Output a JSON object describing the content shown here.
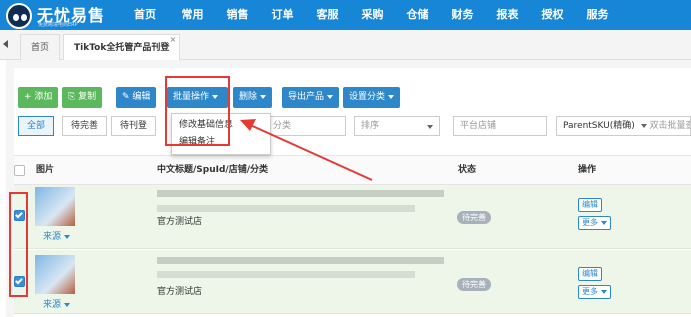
{
  "app": {
    "name": "无忧易售",
    "subtitle": "免费跨境电商ERP"
  },
  "menu": [
    "首页",
    "常用",
    "销售",
    "订单",
    "客服",
    "采购",
    "仓储",
    "财务",
    "报表",
    "授权",
    "服务"
  ],
  "tabs": [
    {
      "label": "首页",
      "active": false
    },
    {
      "label": "TikTok全托管产品刊登",
      "active": true,
      "close": "×"
    }
  ],
  "toolbar": {
    "add": "添加",
    "copy": "复制",
    "edit": "编辑",
    "batch": "批量操作",
    "delete": "删除",
    "export": "导出产品",
    "category": "设置分类"
  },
  "batch_menu": [
    "修改基础信息",
    "编辑备注"
  ],
  "filters": {
    "status_tabs": [
      "全部",
      "待完善",
      "待刊登"
    ],
    "category_placeholder": "分类",
    "sort_placeholder": "排序",
    "store_placeholder": "平台店铺",
    "sku_mode": "ParentSKU(精确)",
    "sku_placeholder": "双击批量查"
  },
  "table": {
    "headers": {
      "image": "图片",
      "title": "中文标题/SpuId/店铺/分类",
      "status": "状态",
      "action": "操作"
    },
    "rows": [
      {
        "checked": true,
        "source": "来源",
        "store": "官方测试店",
        "status": "待完善",
        "edit": "编辑",
        "more": "更多"
      },
      {
        "checked": true,
        "source": "来源",
        "store": "官方测试店",
        "status": "待完善",
        "edit": "编辑",
        "more": "更多"
      }
    ]
  },
  "colors": {
    "nav": "#1886d7",
    "accent": "#2d87c9",
    "add": "#5cb85c",
    "highlight": "#e53935",
    "row": "#eef6e9"
  },
  "icons": [
    "plus-icon",
    "copy-icon",
    "edit-icon",
    "chevron-down-icon",
    "arrow-left-icon",
    "mascot-logo-icon"
  ]
}
